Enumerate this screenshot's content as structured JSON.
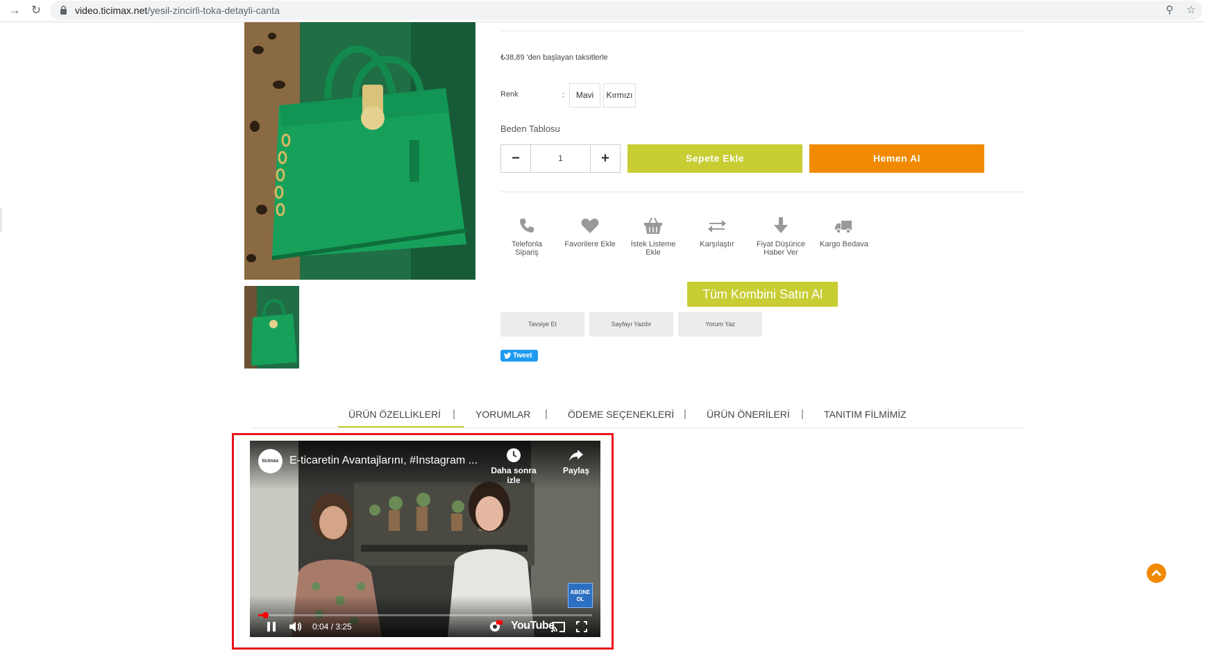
{
  "browser": {
    "url_domain": "video.ticimax.net",
    "url_path": "/yesil-zincirli-toka-detayli-canta"
  },
  "product": {
    "installment_text": "₺38,89  'den başlayan taksitlerle",
    "color_label": "Renk",
    "color_colon": ":",
    "colors": [
      "Mavi",
      "Kırmızı"
    ],
    "size_table_label": "Beden Tablosu",
    "quantity": "1",
    "add_to_cart_label": "Sepete Ekle",
    "buy_now_label": "Hemen Al",
    "combo_label": "Tüm Kombini Satın Al"
  },
  "actions": [
    {
      "line1": "Telefonla",
      "line2": "Sipariş",
      "icon": "phone-icon"
    },
    {
      "line1": "Favorilere Ekle",
      "line2": "",
      "icon": "heart-icon"
    },
    {
      "line1": "İstek Listeme",
      "line2": "Ekle",
      "icon": "basket-icon"
    },
    {
      "line1": "Karşılaştır",
      "line2": "",
      "icon": "compare-arrows-icon"
    },
    {
      "line1": "Fiyat Düşünce",
      "line2": "Haber Ver",
      "icon": "arrow-down-icon"
    },
    {
      "line1": "Kargo Bedava",
      "line2": "",
      "icon": "truck-icon"
    }
  ],
  "secondary_buttons": [
    "Tavsiye Et",
    "Sayfayı Yazdır",
    "Yorum Yaz"
  ],
  "tweet_label": "Tweet",
  "tabs": [
    "ÜRÜN ÖZELLİKLERİ",
    "YORUMLAR",
    "ÖDEME SEÇENEKLERİ",
    "ÜRÜN ÖNERİLERİ",
    "TANITIM FİLMİMİZ"
  ],
  "tab_separator": "|",
  "video": {
    "channel_logo_text": "ticimax",
    "title": "E-ticaretin Avantajlarını, #Instagram ...",
    "watch_later_label": "Daha sonra izle",
    "share_label": "Paylaş",
    "subscribe_text": "ABONE OL",
    "time": "0:04 / 3:25",
    "youtube_label": "YouTube",
    "progress_fraction": 0.02
  },
  "colors": {
    "accent_green": "#c8cd34",
    "accent_orange": "#f18a00",
    "highlight_red": "#e8131b"
  }
}
